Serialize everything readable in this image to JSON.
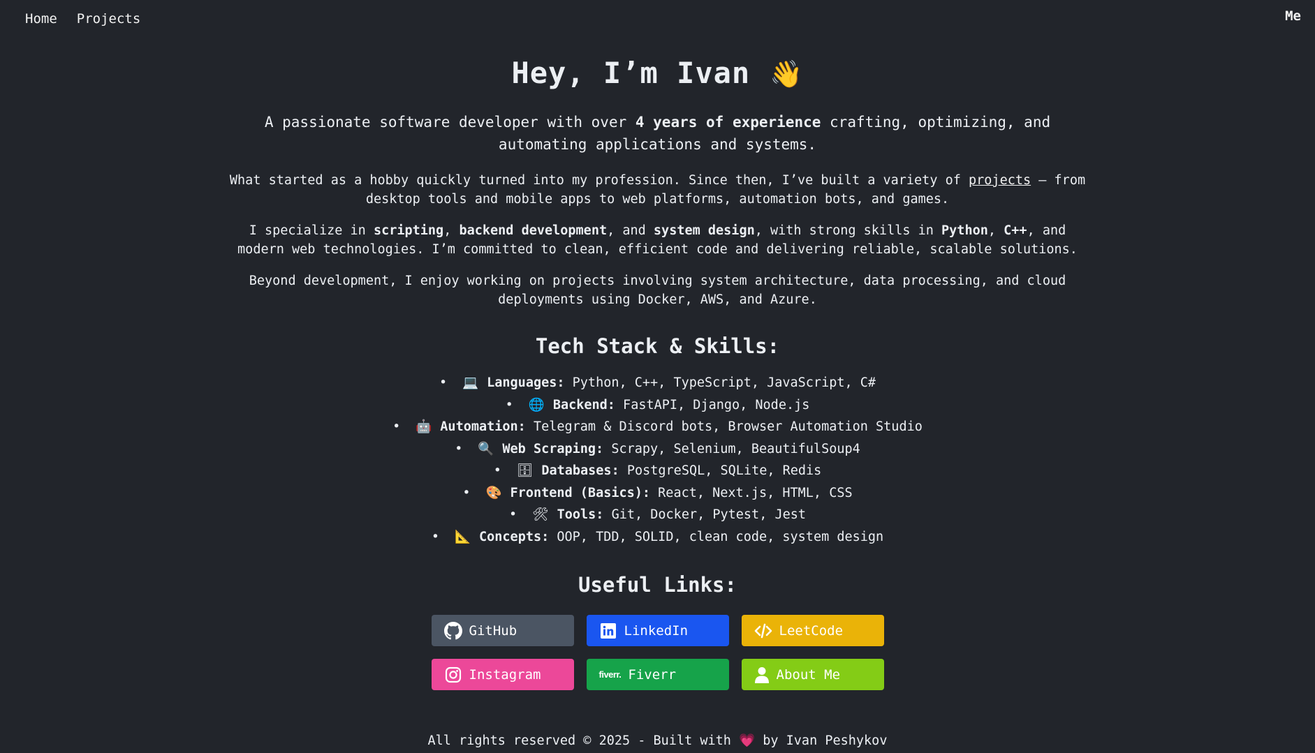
{
  "nav": {
    "home": "Home",
    "projects": "Projects",
    "me": "Me"
  },
  "hero": {
    "title": "Hey, I’m Ivan",
    "wave": "👋",
    "lead_1": "A passionate software developer with over ",
    "lead_bold": "4 years of experience",
    "lead_2": " crafting, optimizing, and automating applications and systems.",
    "p1_a": "What started as a hobby quickly turned into my profession. Since then, I’ve built a variety of ",
    "p1_link": "projects",
    "p1_b": " — from desktop tools and mobile apps to web platforms, automation bots, and games.",
    "p2_a": "I specialize in ",
    "p2_b1": "scripting",
    "p2_c": ", ",
    "p2_b2": "backend development",
    "p2_d": ", and ",
    "p2_b3": "system design",
    "p2_e": ", with strong skills in ",
    "p2_b4": "Python",
    "p2_f": ", ",
    "p2_b5": "C++",
    "p2_g": ", and modern web technologies. I’m committed to clean, efficient code and delivering reliable, scalable solutions.",
    "p3": "Beyond development, I enjoy working on projects involving system architecture, data processing, and cloud deployments using Docker, AWS, and Azure."
  },
  "skills": {
    "title": "Tech Stack & Skills:",
    "bullet": "•",
    "items": [
      {
        "icon": "💻",
        "label": "Languages:",
        "value": " Python, C++, TypeScript, JavaScript, C#"
      },
      {
        "icon": "🌐",
        "label": "Backend:",
        "value": " FastAPI, Django, Node.js"
      },
      {
        "icon": "🤖",
        "label": "Automation:",
        "value": " Telegram & Discord bots, Browser Automation Studio"
      },
      {
        "icon": "🔍",
        "label": "Web Scraping:",
        "value": " Scrapy, Selenium, BeautifulSoup4"
      },
      {
        "icon": "🗄",
        "label": "Databases:",
        "value": " PostgreSQL, SQLite, Redis"
      },
      {
        "icon": "🎨",
        "label": "Frontend (Basics):",
        "value": " React, Next.js, HTML, CSS"
      },
      {
        "icon": "🛠",
        "label": "Tools:",
        "value": " Git, Docker, Pytest, Jest"
      },
      {
        "icon": "📐",
        "label": "Concepts:",
        "value": " OOP, TDD, SOLID, clean code, system design"
      }
    ]
  },
  "links": {
    "title": "Useful Links:",
    "buttons": [
      {
        "label": "GitHub",
        "icon": "github-icon",
        "color": "#4b5563"
      },
      {
        "label": "LinkedIn",
        "icon": "linkedin-icon",
        "color": "#1a56f0"
      },
      {
        "label": "LeetCode",
        "icon": "code-icon",
        "color": "#eab308"
      },
      {
        "label": "Instagram",
        "icon": "instagram-icon",
        "color": "#ec4899"
      },
      {
        "label": "Fiverr",
        "icon": "fiverr-icon",
        "icon_text": "fiverr.",
        "color": "#16a34a"
      },
      {
        "label": "About Me",
        "icon": "user-icon",
        "color": "#84cc16"
      }
    ]
  },
  "footer": {
    "text_a": "All rights reserved © 2025 - Built with ",
    "heart": "💗",
    "text_b": " by Ivan Peshykov"
  }
}
